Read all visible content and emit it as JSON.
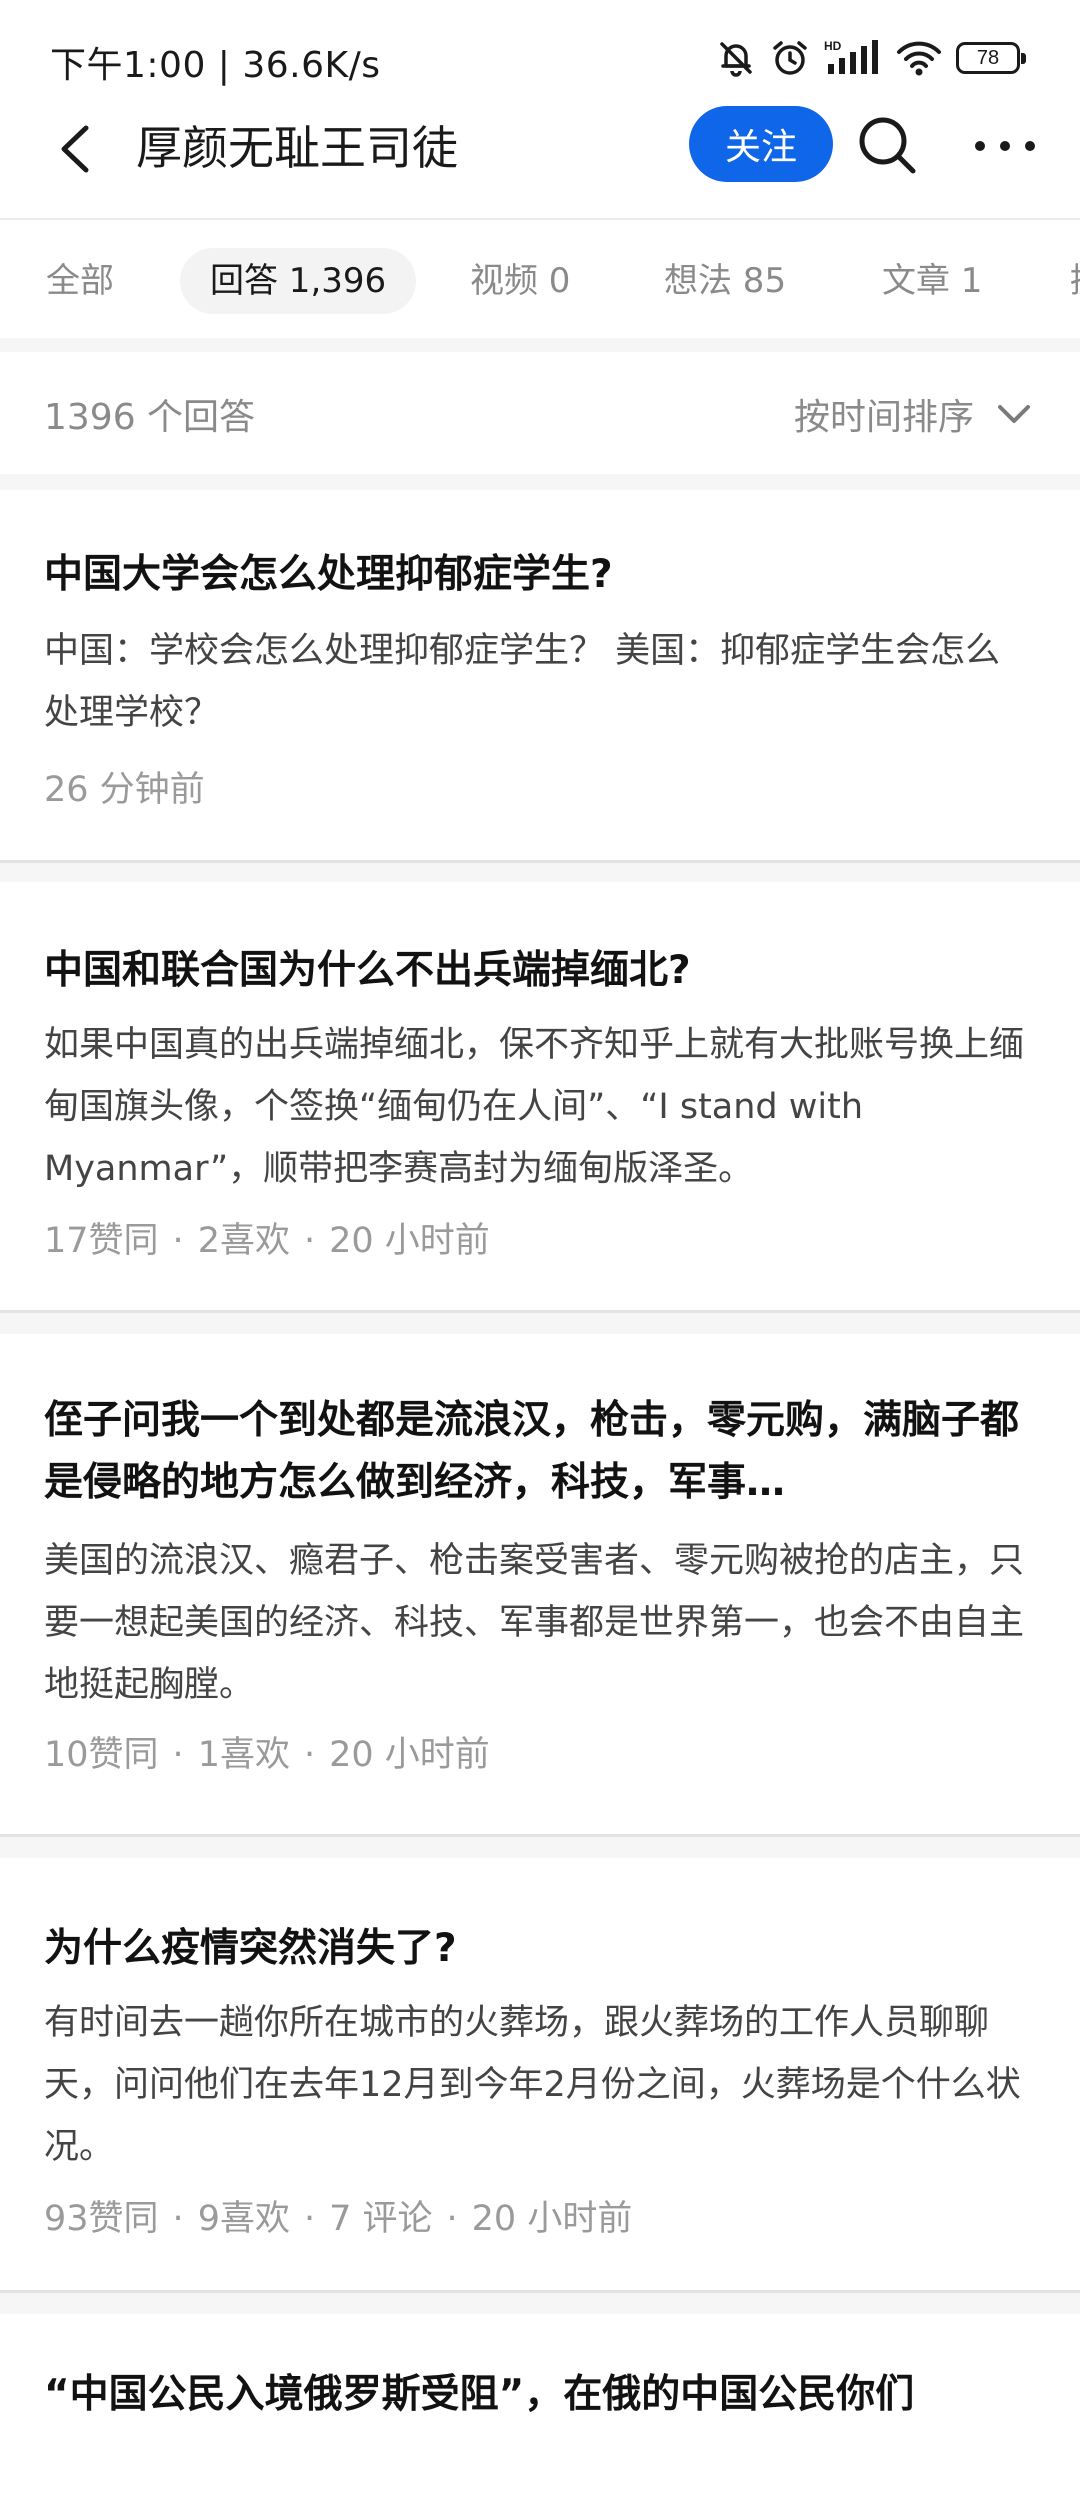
{
  "status_bar": {
    "time_speed": "下午1:00 | 36.6K/s",
    "icons": [
      "bell-off-icon",
      "alarm-icon",
      "hd-signal-icon",
      "wifi-icon",
      "battery-icon"
    ],
    "battery": "78"
  },
  "nav": {
    "title": "厚颜无耻王司徒",
    "follow_label": "关注",
    "accent_color": "#1066e8"
  },
  "tabs": [
    {
      "label": "全部"
    },
    {
      "label": "回答 1,396",
      "active": true
    },
    {
      "label": "视频 0"
    },
    {
      "label": "想法 85"
    },
    {
      "label": "文章 1"
    },
    {
      "label": "提"
    }
  ],
  "list_header": {
    "count": "1396 个回答",
    "sort_label": "按时间排序"
  },
  "answers": [
    {
      "title": "中国大学会怎么处理抑郁症学生?",
      "excerpt": "中国：学校会怎么处理抑郁症学生？ 美国：抑郁症学生会怎么处理学校？",
      "meta": [
        "26 分钟前"
      ]
    },
    {
      "title": "中国和联合国为什么不出兵端掉缅北?",
      "excerpt": "如果中国真的出兵端掉缅北，保不齐知乎上就有大批账号换上缅甸国旗头像，个签换“缅甸仍在人间”、“I stand with Myanmar”，顺带把李赛高封为缅甸版泽圣。",
      "meta": [
        "17赞同",
        "2喜欢",
        "20 小时前"
      ]
    },
    {
      "title": "侄子问我一个到处都是流浪汉，枪击，零元购，满脑子都是侵略的地方怎么做到经济，科技，军事…",
      "excerpt": "美国的流浪汉、瘾君子、枪击案受害者、零元购被抢的店主，只要一想起美国的经济、科技、军事都是世界第一，也会不由自主地挺起胸膛。",
      "meta": [
        "10赞同",
        "1喜欢",
        "20 小时前"
      ]
    },
    {
      "title": "为什么疫情突然消失了?",
      "excerpt": "有时间去一趟你所在城市的火葬场，跟火葬场的工作人员聊聊天，问问他们在去年12月到今年2月份之间，火葬场是个什么状况。",
      "meta": [
        "93赞同",
        "9喜欢",
        "7 评论",
        "20 小时前"
      ]
    },
    {
      "title": "“中国公民入境俄罗斯受阻”，在俄的中国公民你们",
      "excerpt": "",
      "meta": []
    }
  ]
}
